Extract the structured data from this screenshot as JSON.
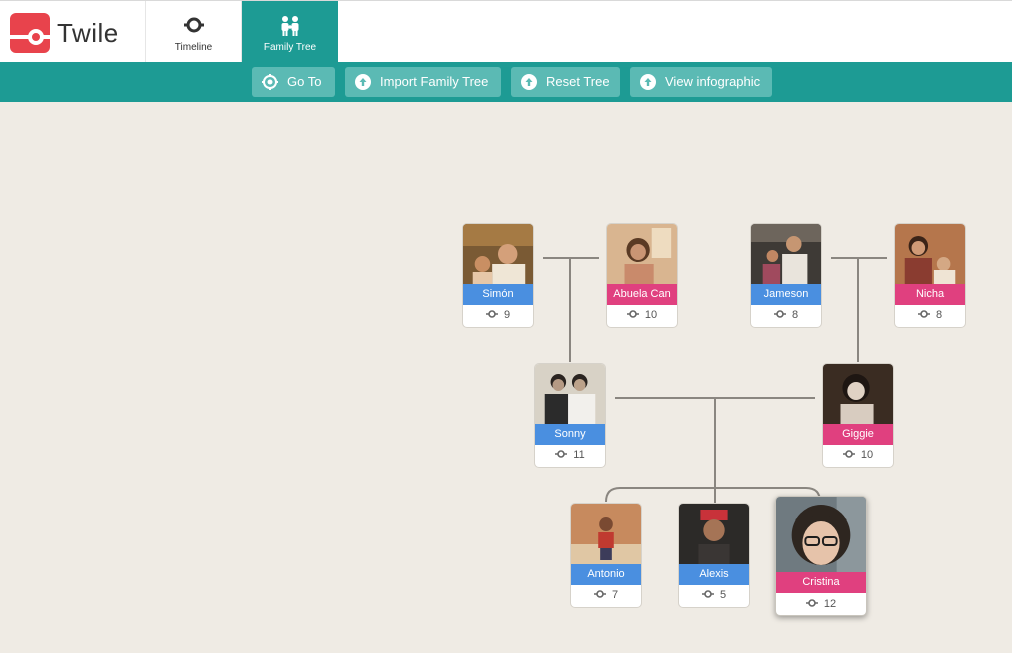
{
  "app": {
    "name": "Twile"
  },
  "nav": {
    "timeline_label": "Timeline",
    "family_tree_label": "Family Tree"
  },
  "toolbar": {
    "goto_label": "Go To",
    "import_label": "Import Family Tree",
    "reset_label": "Reset Tree",
    "infographic_label": "View infographic"
  },
  "people": {
    "simon": {
      "name": "Simón",
      "count": "9",
      "gender": "male"
    },
    "abuela": {
      "name": "Abuela Can",
      "count": "10",
      "gender": "female"
    },
    "jameson": {
      "name": "Jameson",
      "count": "8",
      "gender": "male"
    },
    "nicha": {
      "name": "Nicha",
      "count": "8",
      "gender": "female"
    },
    "sonny": {
      "name": "Sonny",
      "count": "11",
      "gender": "male"
    },
    "giggie": {
      "name": "Giggie",
      "count": "10",
      "gender": "female"
    },
    "antonio": {
      "name": "Antonio",
      "count": "7",
      "gender": "male"
    },
    "alexis": {
      "name": "Alexis",
      "count": "5",
      "gender": "male"
    },
    "cristina": {
      "name": "Cristina",
      "count": "12",
      "gender": "female"
    }
  },
  "colors": {
    "brand_red": "#e8434c",
    "teal": "#1d9b94",
    "male": "#4a8fe0",
    "female": "#e0407f",
    "canvas": "#efebe4"
  }
}
